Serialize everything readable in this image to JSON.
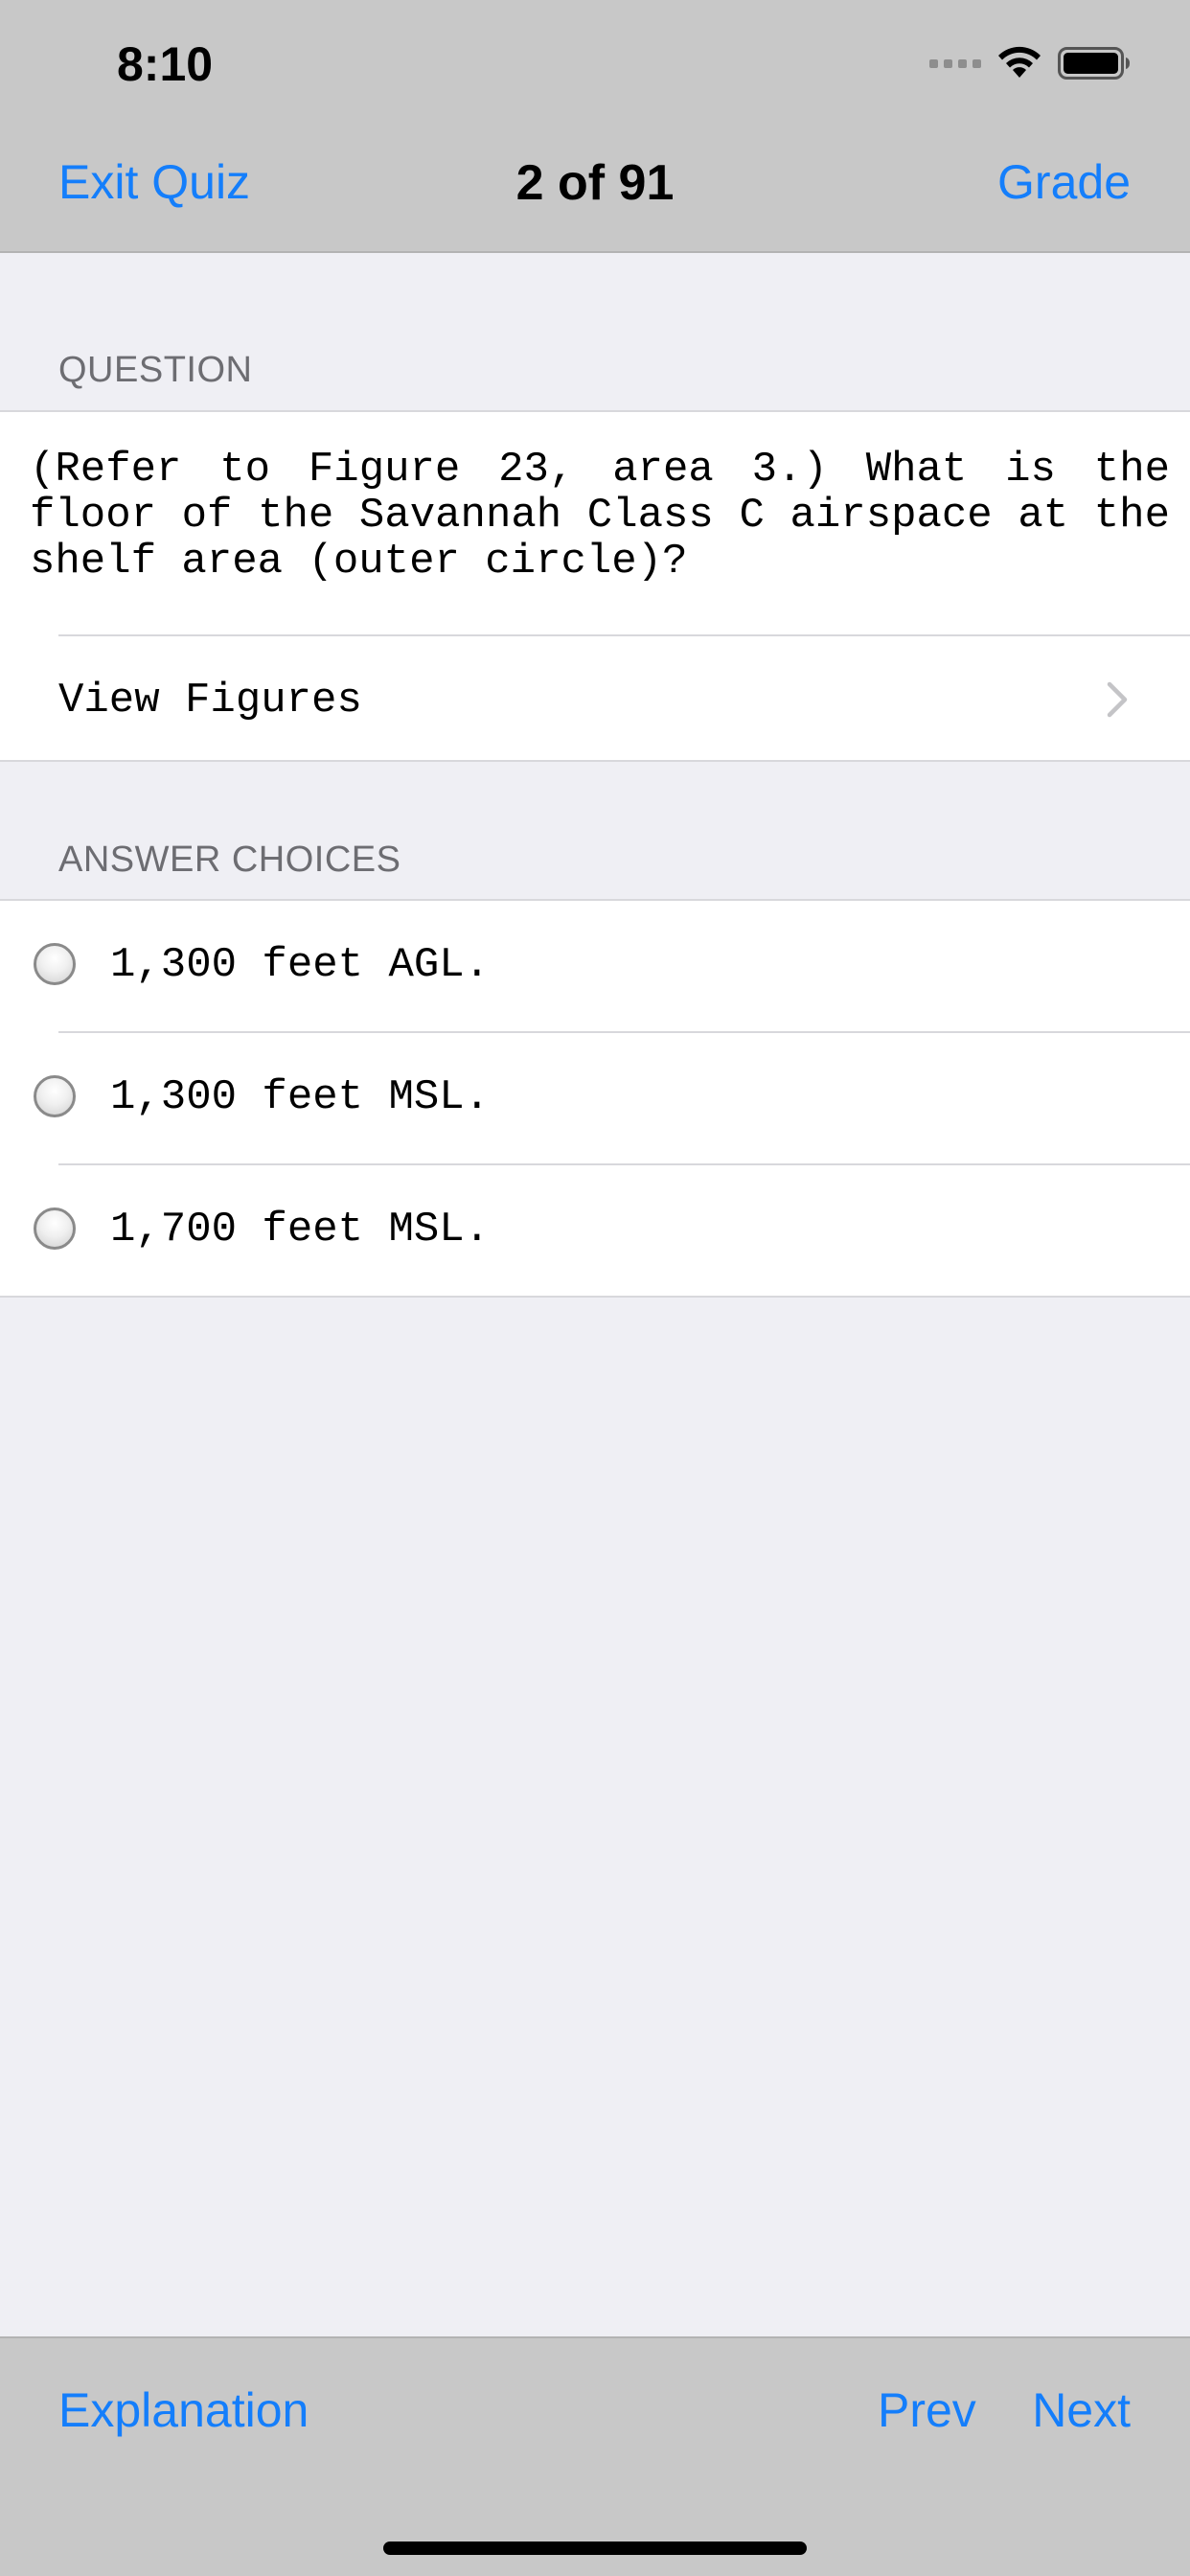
{
  "status_bar": {
    "time": "8:10",
    "icons": [
      "signal-dots-icon",
      "wifi-icon",
      "battery-icon"
    ]
  },
  "nav": {
    "left_label": "Exit Quiz",
    "title": "2 of 91",
    "right_label": "Grade"
  },
  "question_section": {
    "header": "QUESTION",
    "text": "(Refer to Figure 23, area 3.) What is the floor of the Savannah Class C airspace at the shelf area (outer circle)?",
    "view_figures_label": "View Figures"
  },
  "answers_section": {
    "header": "ANSWER CHOICES",
    "choices": [
      {
        "label": "1,300 feet AGL."
      },
      {
        "label": "1,300 feet MSL."
      },
      {
        "label": "1,700 feet MSL."
      }
    ]
  },
  "toolbar": {
    "explanation_label": "Explanation",
    "prev_label": "Prev",
    "next_label": "Next"
  },
  "colors": {
    "accent": "#147efb",
    "bar_background": "#c8c8c8",
    "page_background": "#efeff4"
  }
}
